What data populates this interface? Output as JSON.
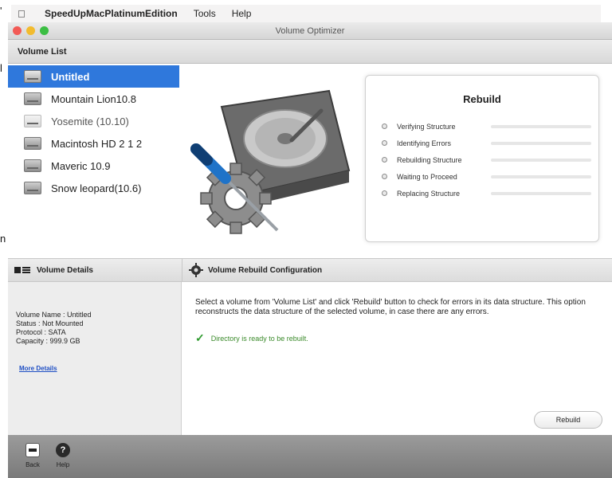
{
  "menubar": {
    "app_name": "SpeedUpMacPlatinumEdition",
    "items": [
      "Tools",
      "Help"
    ]
  },
  "window": {
    "title": "Volume Optimizer"
  },
  "toolbar": {
    "label": "Volume List"
  },
  "volumes": [
    {
      "label": "Untitled",
      "selected": true
    },
    {
      "label": "Mountain Lion10.8"
    },
    {
      "label": "Yosemite (10.10)"
    },
    {
      "label": "Macintosh HD 2 1 2"
    },
    {
      "label": "Maveric 10.9"
    },
    {
      "label": "Snow leopard(10.6)"
    }
  ],
  "rebuild_panel": {
    "title": "Rebuild",
    "steps": [
      "Verifying Structure",
      "Identifying Errors",
      "Rebuilding Structure",
      "Waiting to Proceed",
      "Replacing Structure"
    ]
  },
  "details": {
    "header": "Volume Details",
    "volume_name": "Volume Name : Untitled",
    "status": "Status : Not Mounted",
    "protocol": "Protocol : SATA",
    "capacity": "Capacity : 999.9 GB",
    "more_link": "More Details"
  },
  "config": {
    "header": "Volume Rebuild Configuration",
    "description": "Select a volume from 'Volume List' and click 'Rebuild' button to check for errors in its data structure. This option reconstructs the data structure of the selected volume, in case there are any errors.",
    "ready_text": "Directory is ready to be rebuilt.",
    "rebuild_button": "Rebuild"
  },
  "bottombar": {
    "back_label": "Back",
    "help_label": "Help"
  },
  "colors": {
    "selection": "#2f78dc",
    "ok_green": "#2e9a2e",
    "link": "#1f4fc4"
  }
}
